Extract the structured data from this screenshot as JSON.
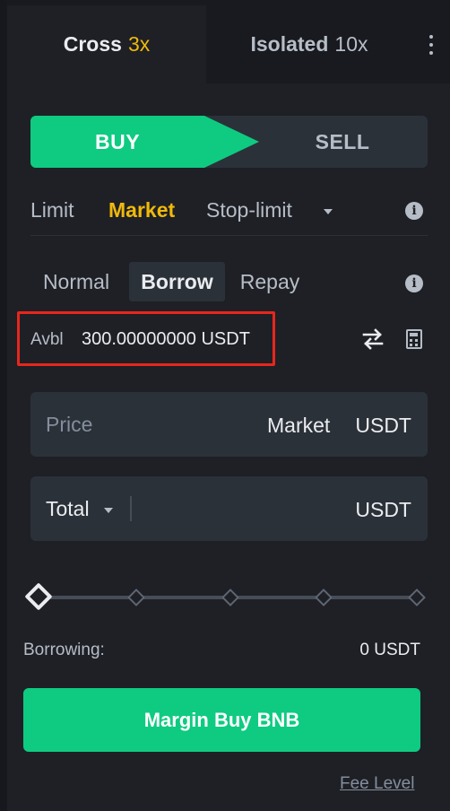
{
  "tabs": {
    "cross": {
      "label": "Cross",
      "leverage": "3x"
    },
    "isolated": {
      "label": "Isolated",
      "leverage": "10x"
    }
  },
  "side": {
    "buy": "BUY",
    "sell": "SELL"
  },
  "order_types": {
    "limit": "Limit",
    "market": "Market",
    "stop_limit": "Stop-limit"
  },
  "modes": {
    "normal": "Normal",
    "borrow": "Borrow",
    "repay": "Repay"
  },
  "available": {
    "label": "Avbl",
    "value": "300.00000000 USDT"
  },
  "price": {
    "placeholder": "Price",
    "value": "Market",
    "unit": "USDT"
  },
  "total": {
    "label": "Total",
    "unit": "USDT"
  },
  "slider": {
    "percent": 0
  },
  "borrowing": {
    "label": "Borrowing:",
    "value": "0 USDT"
  },
  "submit_label": "Margin Buy BNB",
  "fee_level": "Fee Level",
  "colors": {
    "buy": "#0ecb81",
    "accent": "#f0b90b",
    "background": "#1e2026",
    "highlight": "#e8261c"
  }
}
